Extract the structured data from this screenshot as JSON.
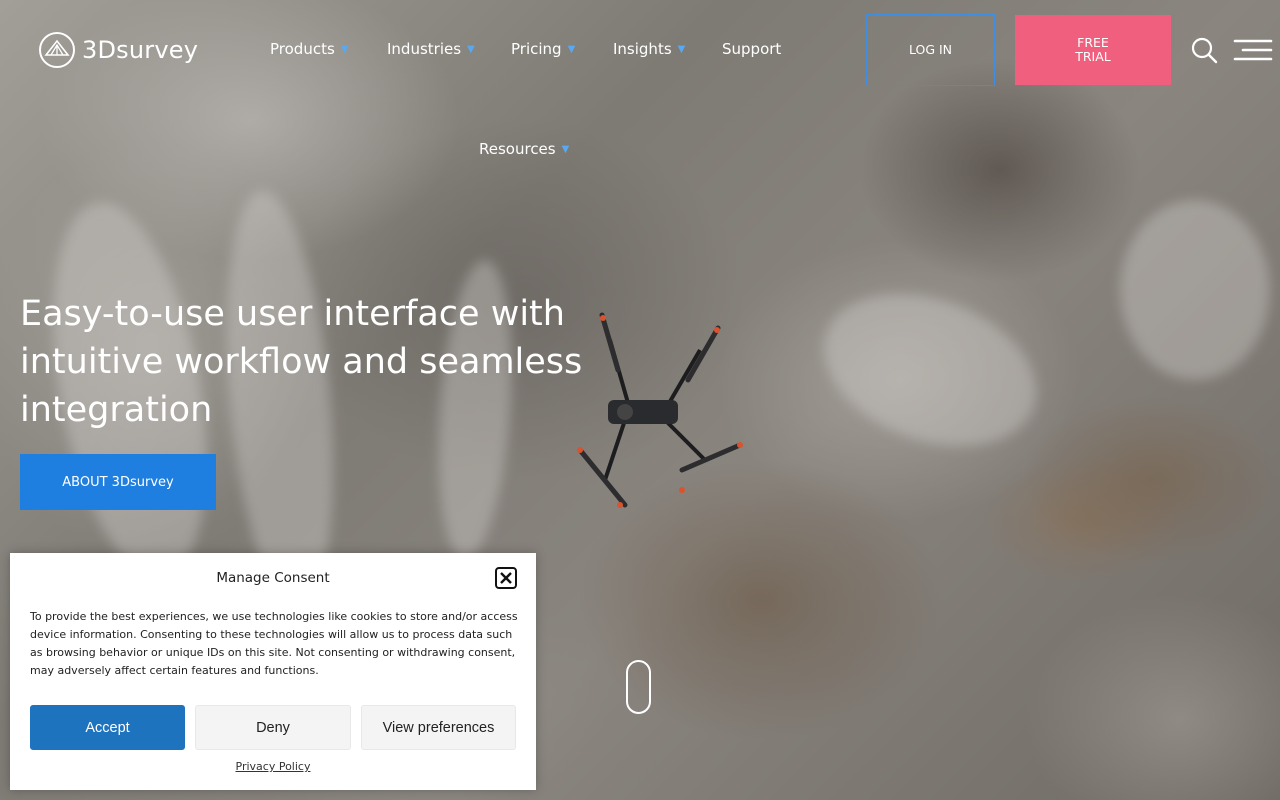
{
  "brand": {
    "name": "3Dsurvey"
  },
  "nav": {
    "items": [
      {
        "label": "Products",
        "dropdown": true
      },
      {
        "label": "Industries",
        "dropdown": true
      },
      {
        "label": "Pricing",
        "dropdown": true
      },
      {
        "label": "Insights",
        "dropdown": true
      },
      {
        "label": "Support",
        "dropdown": false
      },
      {
        "label": "Resources",
        "dropdown": true
      }
    ],
    "login_label": "LOG IN",
    "trial_label": "FREE TRIAL"
  },
  "hero": {
    "title": "Easy-to-use user interface with intuitive workflow and seamless integration",
    "cta_label": "ABOUT 3Dsurvey"
  },
  "consent": {
    "title": "Manage Consent",
    "body": "To provide the best experiences, we use technologies like cookies to store and/or access device information. Consenting to these technologies will allow us to process data such as browsing behavior or unique IDs on this site. Not consenting or withdrawing consent, may adversely affect certain features and functions.",
    "accept_label": "Accept",
    "deny_label": "Deny",
    "preferences_label": "View preferences",
    "privacy_link": "Privacy Policy"
  },
  "colors": {
    "accent_blue": "#1e7fe0",
    "trial_pink": "#f0607e",
    "chevron_blue": "#5aa9f0",
    "accept_blue": "#1e73be"
  },
  "icons": {
    "logo": "3dsurvey-logo-icon",
    "search": "search-icon",
    "menu": "hamburger-menu-icon",
    "close": "close-icon",
    "chevron": "chevron-down-icon"
  }
}
